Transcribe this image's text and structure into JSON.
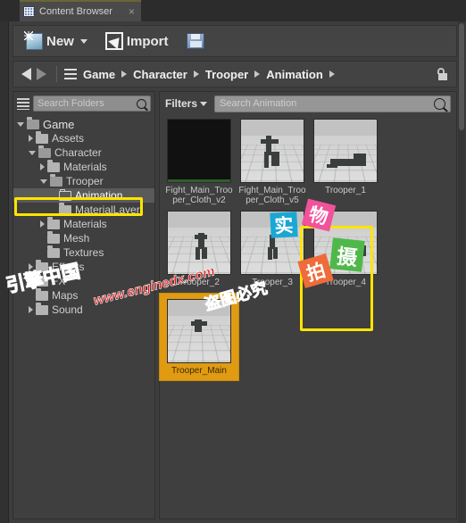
{
  "window": {
    "tab_title": "Content Browser",
    "tab_close_glyph": "×",
    "tab_icon": "content-browser-icon"
  },
  "toolbar": {
    "new_label": "New",
    "new_icon": "new-asset-icon",
    "new_caret": "chevron-down-icon",
    "import_label": "Import",
    "import_icon": "import-arrow-icon",
    "save_icon": "save-all-icon"
  },
  "breadcrumb": {
    "back_icon": "back-arrow-icon",
    "forward_icon": "forward-arrow-icon",
    "path_icon": "path-list-icon",
    "lock_icon": "unlocked-padlock-icon",
    "items": [
      {
        "label": "Game"
      },
      {
        "label": "Character"
      },
      {
        "label": "Trooper"
      },
      {
        "label": "Animation"
      }
    ],
    "separator": "chevron-right-icon"
  },
  "sidebar": {
    "filter_icon": "tree-filter-icon",
    "search_placeholder": "Search Folders",
    "search_value": "",
    "search_icon": "search-icon",
    "tree": [
      {
        "label": "Game",
        "depth": 0,
        "twist": "open",
        "folder": "open",
        "selected": false
      },
      {
        "label": "Assets",
        "depth": 1,
        "twist": "closed",
        "folder": "closed",
        "selected": false
      },
      {
        "label": "Character",
        "depth": 1,
        "twist": "open",
        "folder": "open",
        "selected": false
      },
      {
        "label": "Materials",
        "depth": 2,
        "twist": "closed",
        "folder": "closed",
        "selected": false
      },
      {
        "label": "Trooper",
        "depth": 2,
        "twist": "open",
        "folder": "open",
        "selected": false
      },
      {
        "label": "Animation",
        "depth": 3,
        "twist": "none",
        "folder": "hollow",
        "selected": true
      },
      {
        "label": "MaterialLayer",
        "depth": 3,
        "twist": "none",
        "folder": "closed",
        "selected": false
      },
      {
        "label": "Materials",
        "depth": 2,
        "twist": "closed",
        "folder": "closed",
        "selected": false
      },
      {
        "label": "Mesh",
        "depth": 2,
        "twist": "none",
        "folder": "closed",
        "selected": false
      },
      {
        "label": "Textures",
        "depth": 2,
        "twist": "none",
        "folder": "closed",
        "selected": false
      },
      {
        "label": "Effects",
        "depth": 1,
        "twist": "closed",
        "folder": "closed",
        "selected": false
      },
      {
        "label": "FX",
        "depth": 1,
        "twist": "closed",
        "folder": "closed",
        "selected": false
      },
      {
        "label": "Maps",
        "depth": 1,
        "twist": "none",
        "folder": "closed",
        "selected": false
      },
      {
        "label": "Sound",
        "depth": 1,
        "twist": "closed",
        "folder": "closed",
        "selected": false
      }
    ]
  },
  "assets": {
    "filters_label": "Filters",
    "filters_caret": "chevron-down-icon",
    "search_placeholder": "Search Animation",
    "search_value": "",
    "search_icon": "search-icon",
    "tiles": [
      {
        "name": "Fight_Main_Trooper_Cloth_v2",
        "thumb": "black",
        "selected": false
      },
      {
        "name": "Fight_Main_Trooper_Cloth_v5",
        "thumb": "scene",
        "selected": false
      },
      {
        "name": "Trooper_1",
        "thumb": "scene",
        "selected": false
      },
      {
        "name": "Trooper_2",
        "thumb": "scene",
        "selected": false
      },
      {
        "name": "Trooper_3",
        "thumb": "scene",
        "selected": false
      },
      {
        "name": "Trooper_4",
        "thumb": "scene",
        "selected": false
      },
      {
        "name": "Trooper_Main",
        "thumb": "scene",
        "selected": true
      }
    ]
  },
  "annotations": {
    "color": "#ffe400",
    "targets": [
      "sidebar-animation-folder",
      "asset-tile-trooper-main"
    ]
  },
  "watermarks": {
    "stamp_shi": "实",
    "stamp_wu": "物",
    "stamp_pai": "拍",
    "stamp_she": "摄",
    "brand_cn": "引擎中国",
    "url": "www.enginedx.com",
    "notice": "盗图必究"
  },
  "colors": {
    "panel_bg": "#3d3d3d",
    "accent_selection": "#e09b12",
    "annotation": "#ffe400",
    "stamp_blue": "#1aa7d4",
    "stamp_pink": "#f2529b",
    "stamp_orange": "#ef6b3a",
    "stamp_green": "#4fb84a",
    "brand_purple": "#c04de0",
    "notice_red": "#cf1111"
  }
}
